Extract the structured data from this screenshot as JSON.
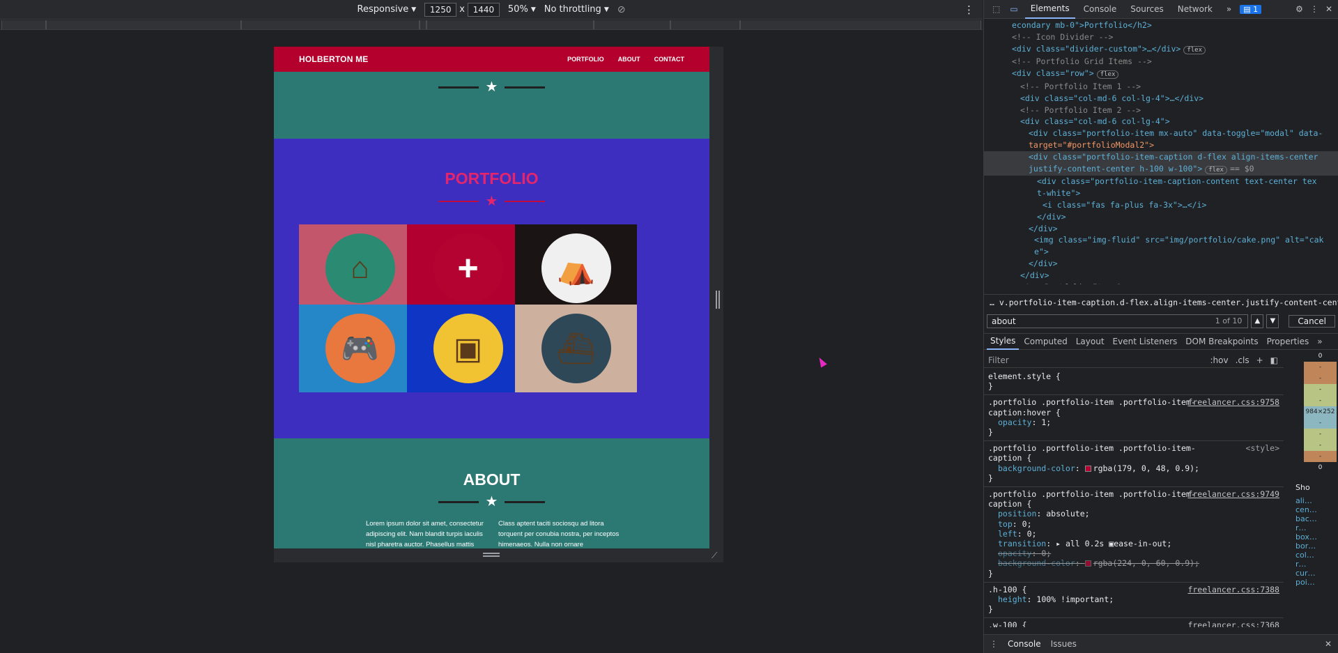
{
  "device_toolbar": {
    "device": "Responsive",
    "width": "1250",
    "times": "x",
    "height": "1440",
    "zoom": "50%",
    "throttling": "No throttling"
  },
  "page": {
    "brand": "HOLBERTON ME",
    "nav": [
      "PORTFOLIO",
      "ABOUT",
      "CONTACT"
    ],
    "portfolio_title": "PORTFOLIO",
    "about_title": "ABOUT",
    "about_left": "Lorem ipsum dolor sit amet, consectetur adipiscing elit. Nam blandit turpis iaculis nisl pharetra auctor. Phasellus mattis",
    "about_right": "Class aptent taciti sociosqu ad litora torquent per conubia nostra, per inceptos himenaeos. Nulla non ornare",
    "tiles": [
      {
        "name": "cabin",
        "bg": "#c3566b",
        "circle": "#2a8b72",
        "glyph": "⌂"
      },
      {
        "name": "cake",
        "bg": "#a8103e",
        "circle": "#c1173d",
        "glyph": ""
      },
      {
        "name": "circus",
        "bg": "#1a1414",
        "circle": "#f0f0f0",
        "glyph": "⛺"
      },
      {
        "name": "game",
        "bg": "#2587c8",
        "circle": "#e8783d",
        "glyph": "🎮"
      },
      {
        "name": "safe",
        "bg": "#0f35c5",
        "circle": "#f1c232",
        "glyph": "▣"
      },
      {
        "name": "submarine",
        "bg": "#cdb19e",
        "circle": "#2f4858",
        "glyph": "⛴"
      }
    ]
  },
  "devtools": {
    "tabs": [
      "Elements",
      "Console",
      "Sources",
      "Network",
      "»"
    ],
    "issues_badge": "1",
    "tree": [
      "econdary mb-0\">Portfolio</h2>",
      "<!-- Icon Divider -->",
      "<div class=\"divider-custom\">…</div>",
      "<!-- Portfolio Grid Items -->",
      "<div class=\"row\">",
      "<!-- Portfolio Item 1 -->",
      "<div class=\"col-md-6 col-lg-4\">…</div>",
      "<!-- Portfolio Item 2 -->",
      "<div class=\"col-md-6 col-lg-4\">",
      "<div class=\"portfolio-item mx-auto\" data-toggle=\"modal\" data-",
      "target=\"#portfolioModal2\">",
      "<div class=\"portfolio-item-caption d-flex align-items-center",
      "justify-content-center h-100 w-100\">",
      "<div class=\"portfolio-item-caption-content text-center tex",
      "t-white\">",
      "<i class=\"fas fa-plus fa-3x\">…</i>",
      "</div>",
      "</div>",
      "<img class=\"img-fluid\" src=\"img/portfolio/cake.png\" alt=\"cak",
      "e\">",
      "</div>",
      "</div>",
      "<!-- Portfolio Item 3 -->"
    ],
    "flex_badge": "flex",
    "selected_marker": "== $0",
    "breadcrumb": "…  v.portfolio-item-caption.d-flex.align-items-center.justify-content-center.h-100.w-100  …",
    "search_value": "about",
    "search_count": "1 of 10",
    "search_cancel": "Cancel",
    "style_tabs": [
      "Styles",
      "Computed",
      "Layout",
      "Event Listeners",
      "DOM Breakpoints",
      "Properties",
      "»"
    ],
    "filter_placeholder": "Filter",
    "filter_tools": [
      ":hov",
      ".cls",
      "+"
    ],
    "rules": [
      {
        "selector": "element.style {",
        "source": "",
        "props": []
      },
      {
        "selector": ".portfolio .portfolio-item .portfolio-item-caption:hover {",
        "source": "freelancer.css:9758",
        "props": [
          {
            "n": "opacity",
            "v": "1;",
            "s": false
          }
        ]
      },
      {
        "selector": ".portfolio .portfolio-item .portfolio-item-caption {",
        "source": "<style>",
        "props": [
          {
            "n": "background-color",
            "v": "rgba(179, 0, 48, 0.9);",
            "s": false,
            "c": "#b30030"
          }
        ]
      },
      {
        "selector": ".portfolio .portfolio-item .portfolio-item-caption {",
        "source": "freelancer.css:9749",
        "props": [
          {
            "n": "position",
            "v": "absolute;",
            "s": false
          },
          {
            "n": "top",
            "v": "0;",
            "s": false
          },
          {
            "n": "left",
            "v": "0;",
            "s": false
          },
          {
            "n": "transition",
            "v": "▸ all 0.2s ▣ease-in-out;",
            "s": false
          },
          {
            "n": "opacity",
            "v": "0;",
            "s": true
          },
          {
            "n": "background-color",
            "v": "rgba(224, 0, 60, 0.9);",
            "s": true,
            "c": "#e0003c"
          }
        ]
      },
      {
        "selector": ".h-100 {",
        "source": "freelancer.css:7388",
        "props": [
          {
            "n": "height",
            "v": "100% !important;",
            "s": false
          }
        ]
      },
      {
        "selector": ".w-100 {",
        "source": "freelancer.css:7368",
        "props": [
          {
            "n": "width",
            "v": "100% !important;",
            "s": false
          }
        ]
      }
    ],
    "box_model_values": [
      "0",
      "-",
      "-",
      "-",
      "-",
      "-",
      "-",
      "-",
      "-",
      "0"
    ],
    "box_model_size": "984×252",
    "right_panel_labels": [
      "Sho",
      "ali…",
      "cen…",
      "bac…",
      "r…",
      "box…",
      "bor…",
      "col…",
      "r…",
      "cur…",
      "poi…"
    ],
    "drawer": [
      "Console",
      "Issues"
    ]
  }
}
